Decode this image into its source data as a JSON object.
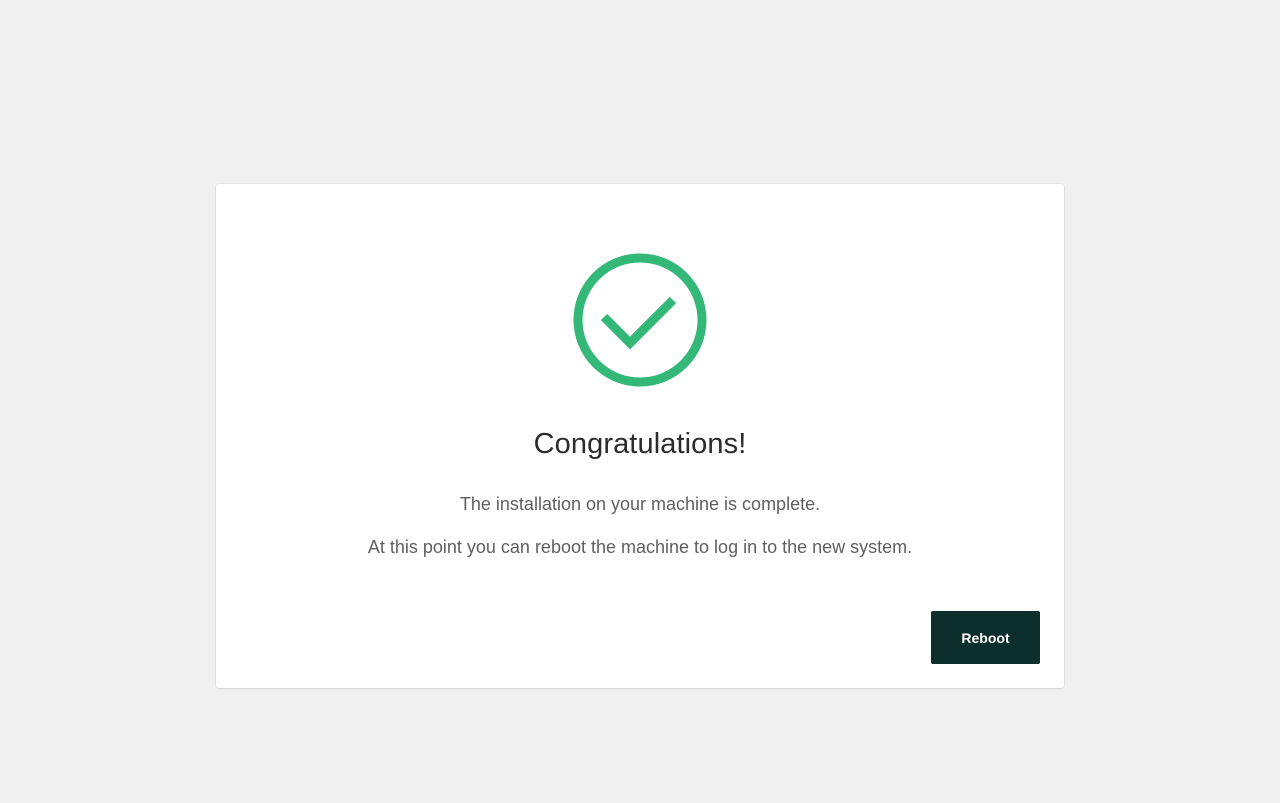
{
  "completion_card": {
    "icon": "check-circle-icon",
    "title": "Congratulations!",
    "messages": [
      "The installation on your machine is complete.",
      "At this point you can reboot the machine to log in to the new system."
    ],
    "reboot_label": "Reboot"
  },
  "colors": {
    "background": "#f0f0f0",
    "card": "#ffffff",
    "success": "#33b878",
    "button": "#0d2f2b",
    "title_text": "#2b2b2b",
    "body_text": "#5f5f5f"
  }
}
